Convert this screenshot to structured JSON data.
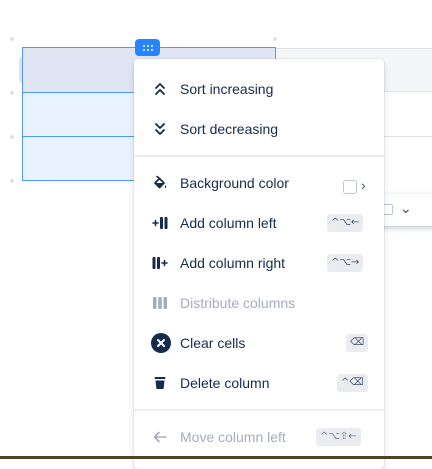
{
  "menu": {
    "sort_increasing": "Sort increasing",
    "sort_decreasing": "Sort decreasing",
    "background_color": "Background color",
    "add_column_left": "Add column left",
    "add_column_left_shortcut": "^⌥←",
    "add_column_right": "Add column right",
    "add_column_right_shortcut": "^⌥→",
    "distribute_columns": "Distribute columns",
    "clear_cells": "Clear cells",
    "clear_cells_shortcut": "⌫",
    "delete_column": "Delete column",
    "delete_column_shortcut": "^⌫",
    "move_column_left": "Move column left",
    "move_column_left_shortcut": "^⌥⇧←"
  },
  "colors": {
    "accent": "#2684ff",
    "selection_border": "#4c9aff",
    "selection_fill": "#e9f2ff",
    "disabled_text": "#a5adba",
    "text": "#172b4d"
  },
  "icons": {
    "sort_increasing": "chevrons-up-icon",
    "sort_decreasing": "chevrons-down-icon",
    "background_color": "paint-bucket-icon",
    "add_column_left": "add-column-left-icon",
    "add_column_right": "add-column-right-icon",
    "distribute_columns": "distribute-columns-icon",
    "clear_cells": "cross-circle-icon",
    "delete_column": "trash-icon",
    "move_column_left": "arrow-left-icon"
  }
}
